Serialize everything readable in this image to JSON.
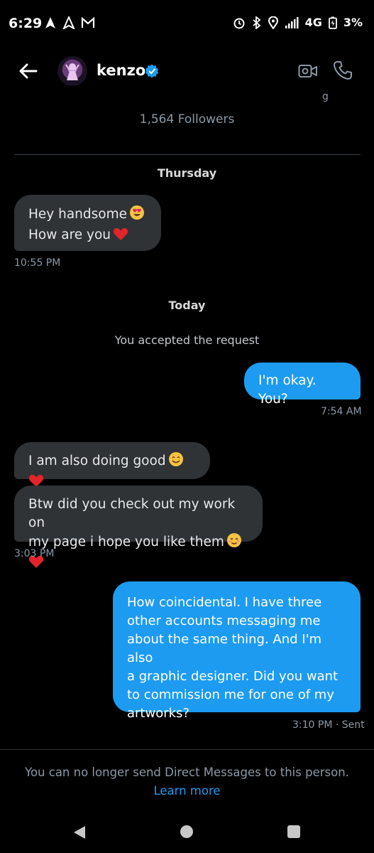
{
  "status_bar": {
    "time": "6:29",
    "network": "4G",
    "battery": "3%"
  },
  "header": {
    "name": "kenzo",
    "followers": "1,564 Followers"
  },
  "conversation": {
    "day1": "Thursday",
    "msg1_line1": "Hey handsome",
    "msg1_line2": "How are you",
    "msg1_time": "10:55 PM",
    "day2": "Today",
    "system_note": "You accepted the request",
    "msg2_text": "I'm okay. You?",
    "msg2_time": "7:54 AM",
    "msg3_text": "I am also doing good",
    "msg4_line1": "Btw did you check out my work on",
    "msg4_line2": "my page i hope you like them",
    "msg4_time": "3:03 PM",
    "msg5_lines": [
      "How coincidental. I have three",
      "other accounts messaging me",
      "about the same thing. And I'm also",
      "a graphic designer. Did you want",
      "to commission me for one of my",
      "artworks?"
    ],
    "msg5_time": "3:10 PM · Sent"
  },
  "footer": {
    "notice": "You can no longer send Direct Messages to this person.",
    "learn_more": "Learn more"
  },
  "colors": {
    "background": "#000000",
    "incoming_bubble": "#2f3336",
    "outgoing_bubble": "#1d9bf0",
    "accent": "#1d9bf0",
    "muted_text": "#8b98a5"
  },
  "icons": {
    "heart": "red-heart-emoji",
    "heart_eyes": "smiling-face-with-heart-eyes-emoji",
    "smile": "smiling-face-emoji",
    "blush": "relieved-face-emoji"
  }
}
